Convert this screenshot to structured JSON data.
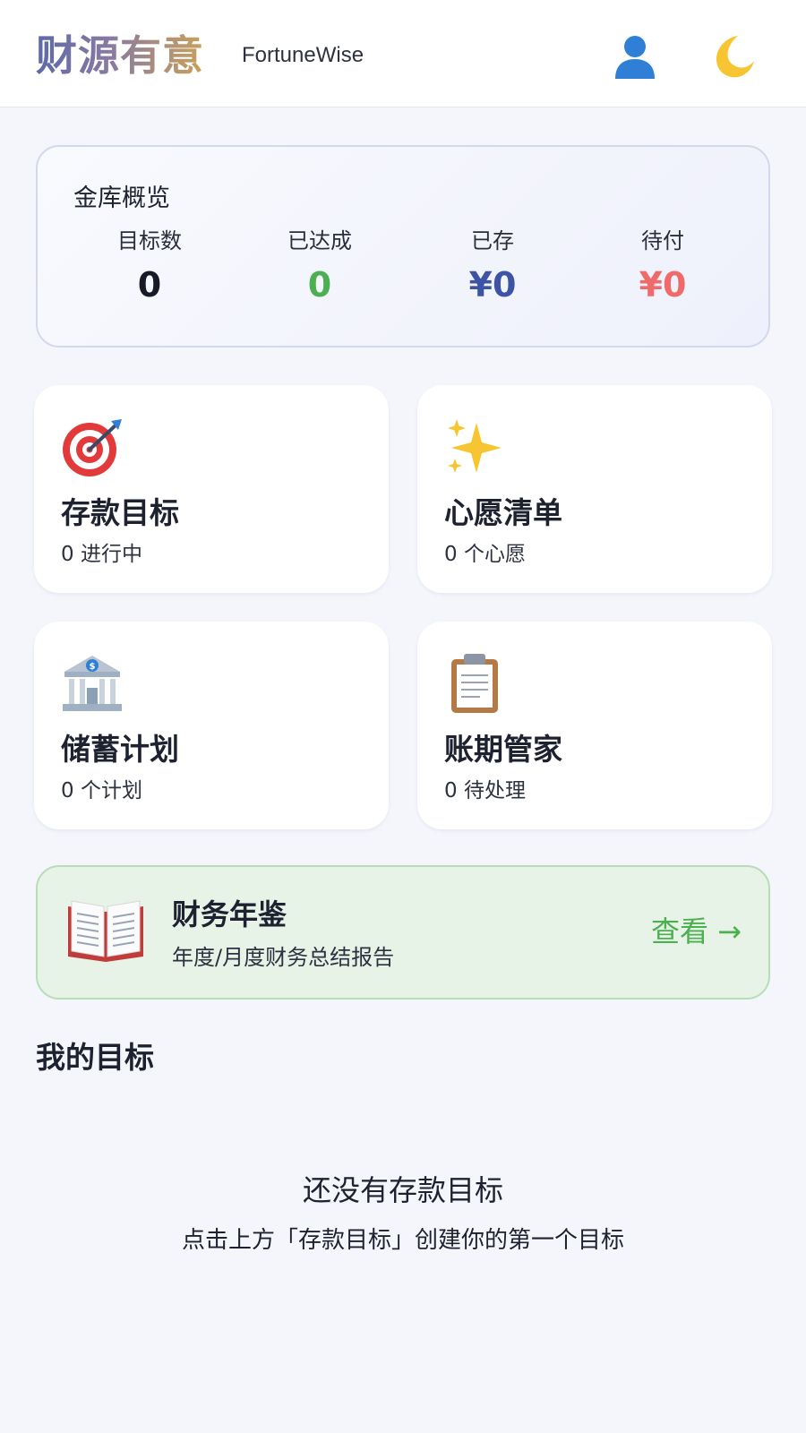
{
  "header": {
    "brand": "财源有意",
    "brand_sub": "FortuneWise",
    "user_icon": "user-icon",
    "theme_icon": "moon-icon"
  },
  "overview": {
    "title": "金库概览",
    "stats": [
      {
        "label": "目标数",
        "value": "0",
        "color": "#181b26"
      },
      {
        "label": "已达成",
        "value": "0",
        "color": "#4caf50"
      },
      {
        "label": "已存",
        "value": "¥0",
        "color": "#3d53a6"
      },
      {
        "label": "待付",
        "value": "¥0",
        "color": "#f06a6a"
      }
    ]
  },
  "features": [
    {
      "icon": "target-icon",
      "title": "存款目标",
      "subtitle": "0 进行中"
    },
    {
      "icon": "sparkles-icon",
      "title": "心愿清单",
      "subtitle": "0 个心愿"
    },
    {
      "icon": "bank-icon",
      "title": "储蓄计划",
      "subtitle": "0 个计划"
    },
    {
      "icon": "clipboard-icon",
      "title": "账期管家",
      "subtitle": "0 待处理"
    }
  ],
  "report": {
    "icon": "open-book-icon",
    "title": "财务年鉴",
    "subtitle": "年度/月度财务总结报告",
    "link": "查看 →",
    "accent": "#4caf50"
  },
  "goals": {
    "title": "我的目标",
    "empty_title": "还没有存款目标",
    "empty_hint": "点击上方「存款目标」创建你的第一个目标"
  }
}
